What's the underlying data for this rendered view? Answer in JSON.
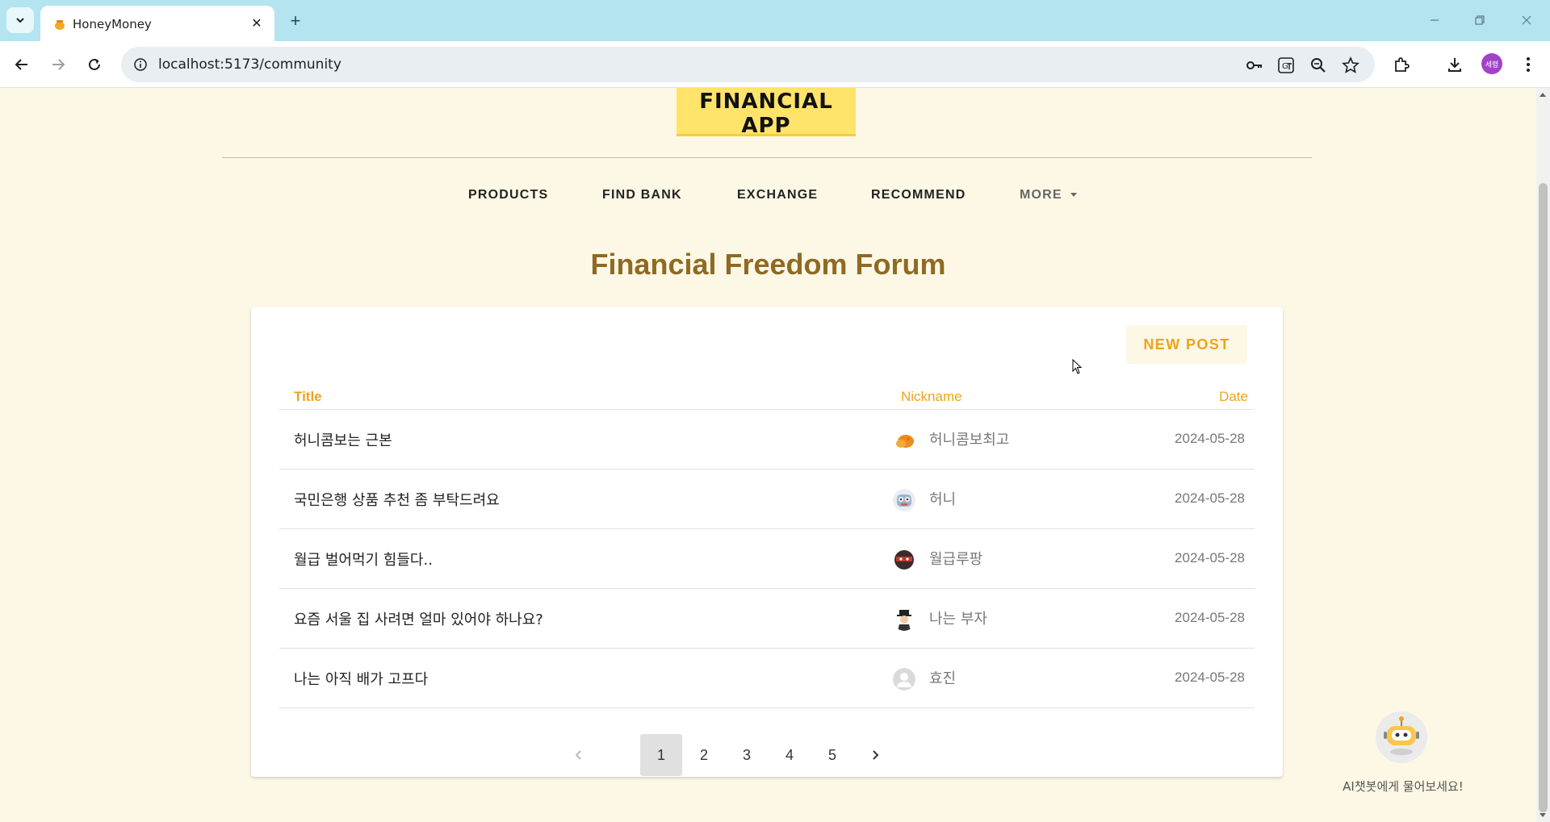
{
  "browser": {
    "tab_title": "HoneyMoney",
    "tab_close": "✕",
    "new_tab": "+",
    "url": "localhost:5173/community",
    "profile_label": "세령",
    "window_controls": [
      "minimize-icon",
      "restore-icon",
      "close-icon"
    ]
  },
  "logo": {
    "text": "FINANCIAL APP"
  },
  "nav": {
    "items": [
      {
        "label": "PRODUCTS"
      },
      {
        "label": "FIND BANK"
      },
      {
        "label": "EXCHANGE"
      },
      {
        "label": "RECOMMEND"
      },
      {
        "label": "MORE"
      }
    ]
  },
  "forum": {
    "title": "Financial Freedom Forum",
    "new_post_label": "NEW POST",
    "columns": {
      "title": "Title",
      "nickname": "Nickname",
      "date": "Date"
    },
    "posts": [
      {
        "title": "허니콤보는 근본",
        "nickname": "허니콤보최고",
        "date": "2024-05-28",
        "avatar": "honeycombo-avatar-icon"
      },
      {
        "title": "국민은행 상품 추천 좀 부탁드려요",
        "nickname": "허니",
        "date": "2024-05-28",
        "avatar": "robot-avatar-icon"
      },
      {
        "title": "월급 벌어먹기 힘들다..",
        "nickname": "월급루팡",
        "date": "2024-05-28",
        "avatar": "ninja-avatar-icon"
      },
      {
        "title": "요즘 서울 집 사려면 얼마 있어야 하나요?",
        "nickname": "나는 부자",
        "date": "2024-05-28",
        "avatar": "rich-man-avatar-icon"
      },
      {
        "title": "나는 아직 배가 고프다",
        "nickname": "효진",
        "date": "2024-05-28",
        "avatar": "default-user-avatar-icon"
      }
    ]
  },
  "pagination": {
    "prev": "‹",
    "next": "›",
    "pages": [
      "1",
      "2",
      "3",
      "4",
      "5"
    ],
    "current": "1"
  },
  "chatbot": {
    "label": "AI챗봇에게 물어보세요!"
  },
  "colors": {
    "accent": "#f0a21b",
    "title_brown": "#8f6a23",
    "page_bg": "#fdf8e6"
  }
}
